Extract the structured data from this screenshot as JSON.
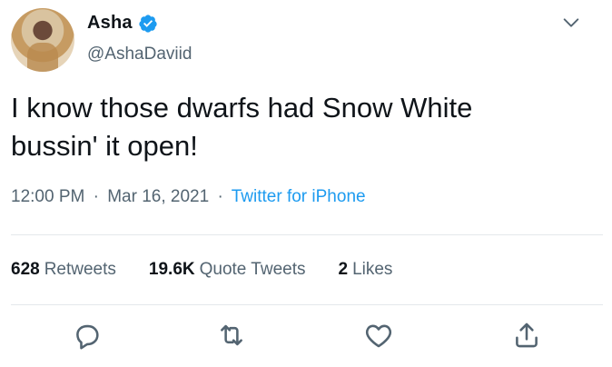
{
  "author": {
    "display_name": "Asha",
    "handle": "@AshaDaviid",
    "verified": true
  },
  "tweet": {
    "text_line1": "I know those dwarfs had Snow White",
    "text_line2": "bussin' it open!",
    "time": "12:00 PM",
    "date": "Mar 16, 2021",
    "source": "Twitter for iPhone",
    "separator": "·"
  },
  "stats": {
    "retweets_count": "628",
    "retweets_label": "Retweets",
    "quote_count": "19.6K",
    "quote_label": "Quote Tweets",
    "likes_count": "2",
    "likes_label": "Likes"
  },
  "icons": {
    "verified": "verified-badge-icon",
    "more": "chevron-down-icon",
    "reply": "reply-icon",
    "retweet": "retweet-icon",
    "like": "heart-icon",
    "share": "share-icon"
  },
  "colors": {
    "accent": "#1d9bf0",
    "text": "#0f1419",
    "secondary": "#536471"
  }
}
